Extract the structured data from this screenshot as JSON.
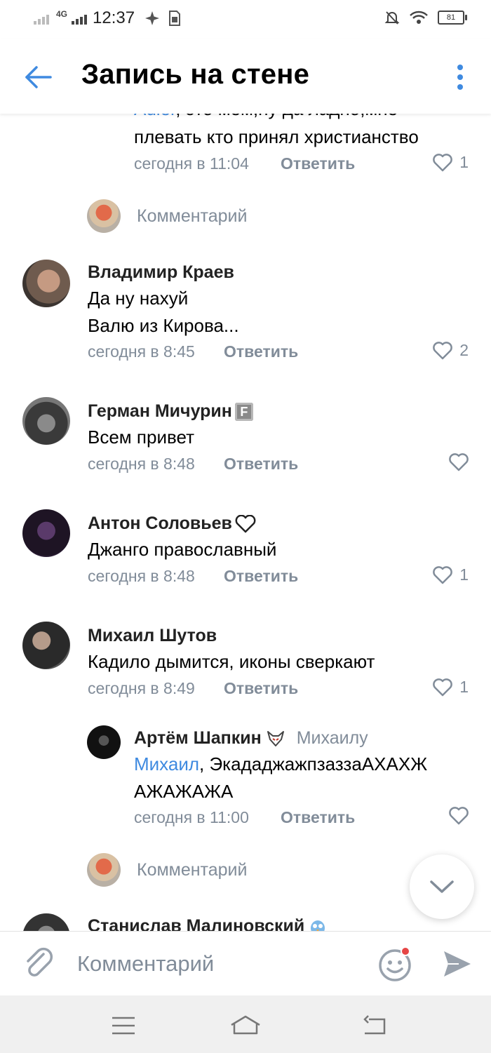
{
  "status_bar": {
    "network": "4G",
    "time": "12:37",
    "battery": "81"
  },
  "header": {
    "title": "Запись на стене"
  },
  "top_partial_comment": {
    "mention": "Adler",
    "line1_rest": ", это мем,ну да ладно,мне",
    "line2": "плевать кто принял христианство",
    "time": "сегодня в 11:04",
    "reply_label": "Ответить",
    "likes": "1"
  },
  "comment_placeholder": "Комментарий",
  "comments": [
    {
      "author": "Владимир Краев",
      "lines": [
        "Да ну нахуй",
        "Валю из Кирова..."
      ],
      "time": "сегодня в 8:45",
      "reply_label": "Ответить",
      "likes": "2"
    },
    {
      "author": "Герман Мичурин",
      "badge": "F",
      "lines": [
        "Всем привет"
      ],
      "time": "сегодня в 8:48",
      "reply_label": "Ответить",
      "likes": ""
    },
    {
      "author": "Антон Соловьев",
      "lines": [
        "Джанго православный"
      ],
      "time": "сегодня в 8:48",
      "reply_label": "Ответить",
      "likes": "1"
    },
    {
      "author": "Михаил Шутов",
      "lines": [
        "Кадило дымится, иконы сверкают"
      ],
      "time": "сегодня в 8:49",
      "reply_label": "Ответить",
      "likes": "1"
    }
  ],
  "nested_reply": {
    "author": "Артём Шапкин",
    "reply_to": "Михаилу",
    "mention": "Михаил",
    "line1_rest": ", ЭкададжажпзаззаАХАХЖ",
    "line2": "АЖАЖАЖА",
    "time": "сегодня в 11:00",
    "reply_label": "Ответить",
    "likes": ""
  },
  "bottom_partial_author": "Станислав Малиновский",
  "composer": {
    "placeholder": "Комментарий"
  },
  "colors": {
    "accent": "#3f8ae0",
    "muted": "#818c99",
    "notification_dot": "#e64646"
  }
}
